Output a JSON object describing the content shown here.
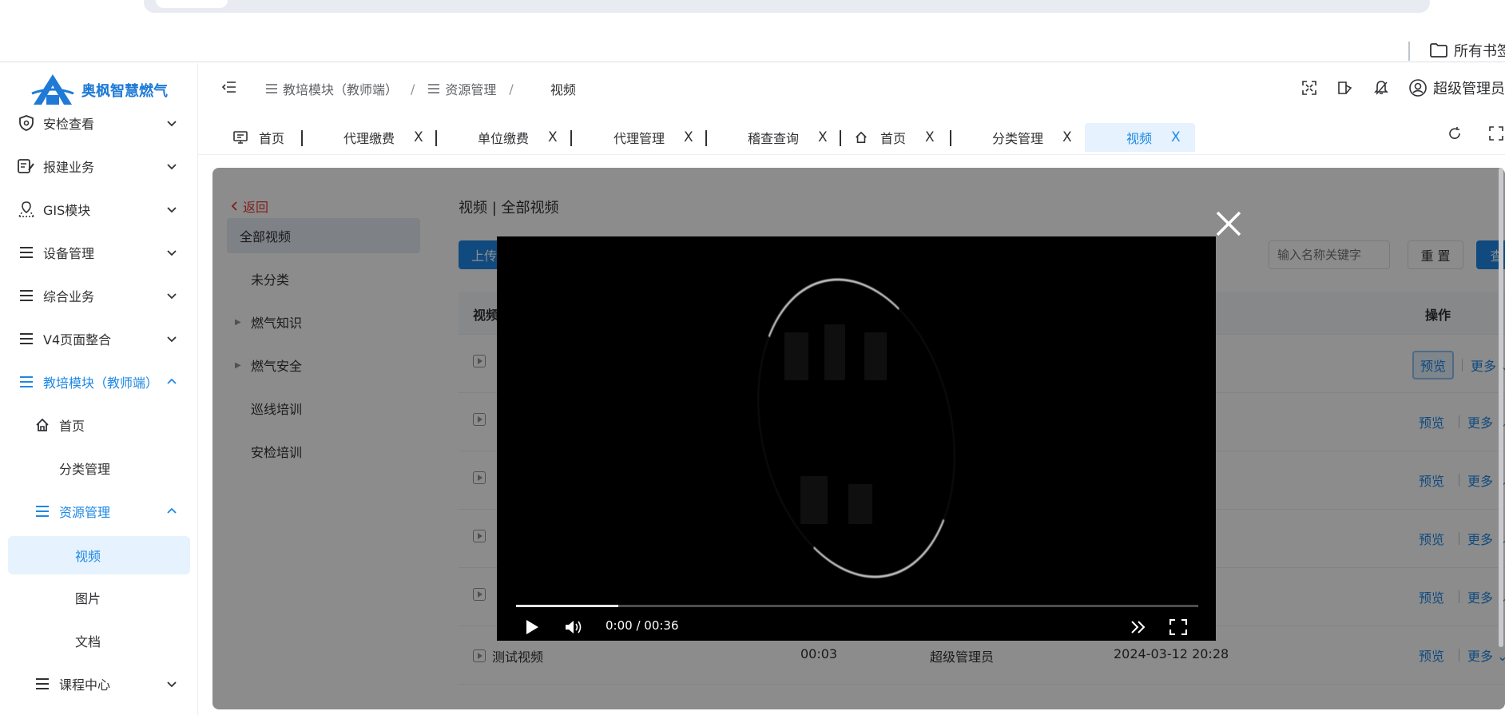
{
  "bookmarks": {
    "folder_label": "所有书签"
  },
  "logo": {
    "text": "奥枫智慧燃气"
  },
  "sidebar": {
    "items": [
      {
        "label": "安检查看"
      },
      {
        "label": "报建业务"
      },
      {
        "label": "GIS模块"
      },
      {
        "label": "设备管理"
      },
      {
        "label": "综合业务"
      },
      {
        "label": "V4页面整合"
      },
      {
        "label": "教培模块（教师端）"
      },
      {
        "label": "首页"
      },
      {
        "label": "分类管理"
      },
      {
        "label": "资源管理"
      },
      {
        "label": "视频"
      },
      {
        "label": "图片"
      },
      {
        "label": "文档"
      },
      {
        "label": "课程中心"
      }
    ]
  },
  "header": {
    "breadcrumb": [
      "教培模块（教师端）",
      "资源管理",
      "视频"
    ],
    "user": "超级管理员"
  },
  "tabs": [
    {
      "label": "首页"
    },
    {
      "label": "代理缴费"
    },
    {
      "label": "单位缴费"
    },
    {
      "label": "代理管理"
    },
    {
      "label": "稽查查询"
    },
    {
      "label": "首页"
    },
    {
      "label": "分类管理"
    },
    {
      "label": "视频"
    }
  ],
  "categories": {
    "back": "返回",
    "items": [
      {
        "label": "全部视频"
      },
      {
        "label": "未分类"
      },
      {
        "label": "燃气知识"
      },
      {
        "label": "燃气安全"
      },
      {
        "label": "巡线培训"
      },
      {
        "label": "安检培训"
      }
    ]
  },
  "main": {
    "title": "视频 | 全部视频",
    "upload_label": "上传",
    "search_placeholder": "输入名称关键字",
    "reset_label": "重 置",
    "query_label": "查 询",
    "columns": {
      "name": "视频",
      "actions": "操作"
    },
    "preview_label": "预览",
    "more_label": "更多",
    "last_row": {
      "name": "测试视频",
      "duration": "00:03",
      "uploader": "超级管理员",
      "time": "2024-03-12 20:28"
    }
  },
  "video": {
    "time_display": "0:00 / 00:36",
    "progress": 0.15
  }
}
